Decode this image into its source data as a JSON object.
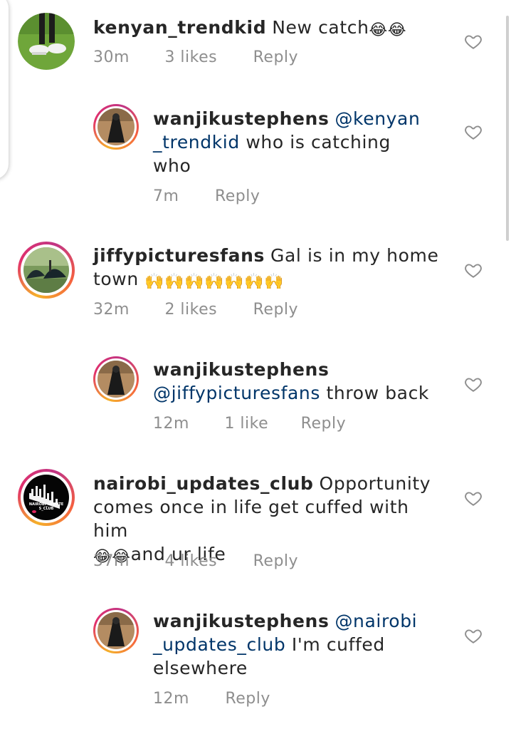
{
  "comments": [
    {
      "username": "kenyan_trendkid",
      "text_before": "New catch",
      "emoji": "😂😂",
      "time": "30m",
      "likes": "3 likes",
      "reply_label": "Reply"
    },
    {
      "username": "wanjikustephens",
      "mention_line1": "@kenyan",
      "mention_line2": "_trendkid",
      "text": "who is catching",
      "text_line3": "who",
      "time": "7m",
      "reply_label": "Reply"
    },
    {
      "username": "jiffypicturesfans",
      "text_line1": "Gal is in my home",
      "text_line2": "town",
      "emoji": "🙌🙌🙌🙌🙌🙌🙌",
      "time": "32m",
      "likes": "2 likes",
      "reply_label": "Reply"
    },
    {
      "username": "wanjikustephens",
      "mention": "@jiffypicturesfans",
      "text": "throw back",
      "time": "12m",
      "likes": "1 like",
      "reply_label": "Reply"
    },
    {
      "username": "nairobi_updates_club",
      "text_line1": "Opportunity",
      "text_line2": "comes once in life get cuffed with him",
      "emoji": "😂😂",
      "text_line3": "and ur life",
      "time": "37m",
      "likes": "4 likes",
      "reply_label": "Reply",
      "avatar_text": "NAIROBI_UPDATE S_CLUB"
    },
    {
      "username": "wanjikustephens",
      "mention_line1": "@nairobi",
      "mention_line2": "_updates_club",
      "text_line2": "I'm cuffed",
      "text_line3": "elsewhere",
      "time": "12m",
      "reply_label": "Reply"
    }
  ],
  "icons": {
    "like": "heart-outline-icon"
  },
  "colors": {
    "text": "#262626",
    "meta": "#8e8e8e",
    "mention": "#003569",
    "heart": "#8e8e8e",
    "ring_start": "#f5b02a",
    "ring_end": "#c13584"
  }
}
